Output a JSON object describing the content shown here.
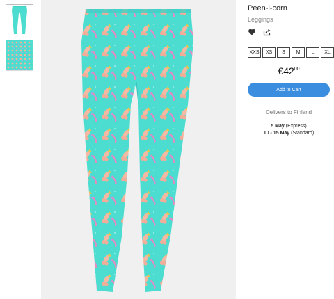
{
  "product": {
    "title": "Peen-i-corn",
    "type": "Leggings",
    "price_main": "€42",
    "price_cents": "00",
    "add_to_cart": "Add to Cart"
  },
  "thumbnails": [
    {
      "name": "leggings-front"
    },
    {
      "name": "pattern-swatch"
    }
  ],
  "sizes": [
    "XXS",
    "XS",
    "S",
    "M",
    "L",
    "XL"
  ],
  "delivery": {
    "heading": "Delivers to Finland",
    "express_date": "5 May",
    "express_label": "(Express)",
    "standard_date": "10 - 15 May",
    "standard_label": "(Standard)"
  },
  "icons": {
    "favorite": "heart-icon",
    "share": "share-icon"
  },
  "colors": {
    "accent": "#3b8de0",
    "pattern_bg": "#4cddd0",
    "stage_bg": "#f0f0f0"
  }
}
